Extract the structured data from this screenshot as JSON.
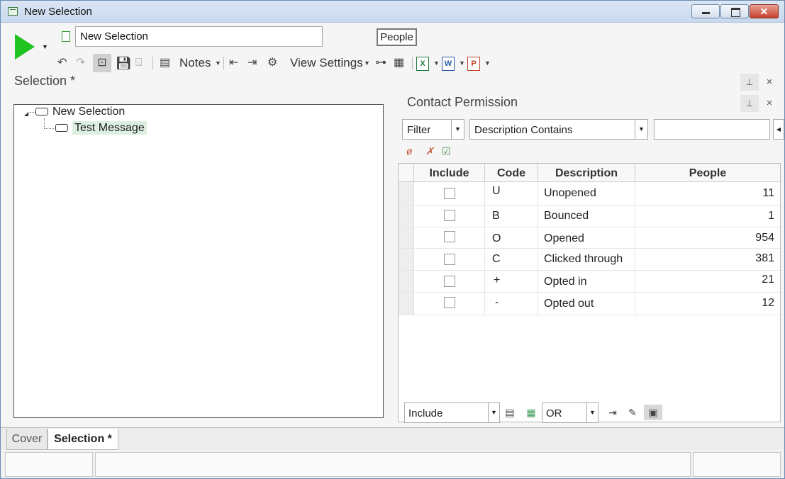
{
  "window": {
    "title": "New Selection"
  },
  "header": {
    "name_value": "New Selection",
    "people_label": "People",
    "notes_label": "Notes",
    "view_settings_label": "View Settings"
  },
  "selection_panel": {
    "title": "Selection *",
    "tree": {
      "root_label": "New Selection",
      "child_label": "Test Message"
    }
  },
  "contact_permission": {
    "title": "Contact Permission",
    "filter_label": "Filter",
    "filter_mode": "Description Contains",
    "filter_value": "",
    "columns": [
      "Include",
      "Code",
      "Description",
      "People"
    ],
    "rows": [
      {
        "code": "U",
        "description": "Unopened",
        "people": "11"
      },
      {
        "code": "B",
        "description": "Bounced",
        "people": "1"
      },
      {
        "code": "O",
        "description": "Opened",
        "people": "954"
      },
      {
        "code": "C",
        "description": "Clicked through",
        "people": "381"
      },
      {
        "code": "+",
        "description": "Opted in",
        "people": "21"
      },
      {
        "code": "-",
        "description": "Opted out",
        "people": "12"
      }
    ],
    "include_mode": "Include",
    "logic_operator": "OR"
  },
  "tabs": [
    {
      "label": "Cover"
    },
    {
      "label": "Selection *"
    }
  ],
  "colors": {
    "run_green": "#21c321",
    "tree_selection": "#dcefe1"
  }
}
